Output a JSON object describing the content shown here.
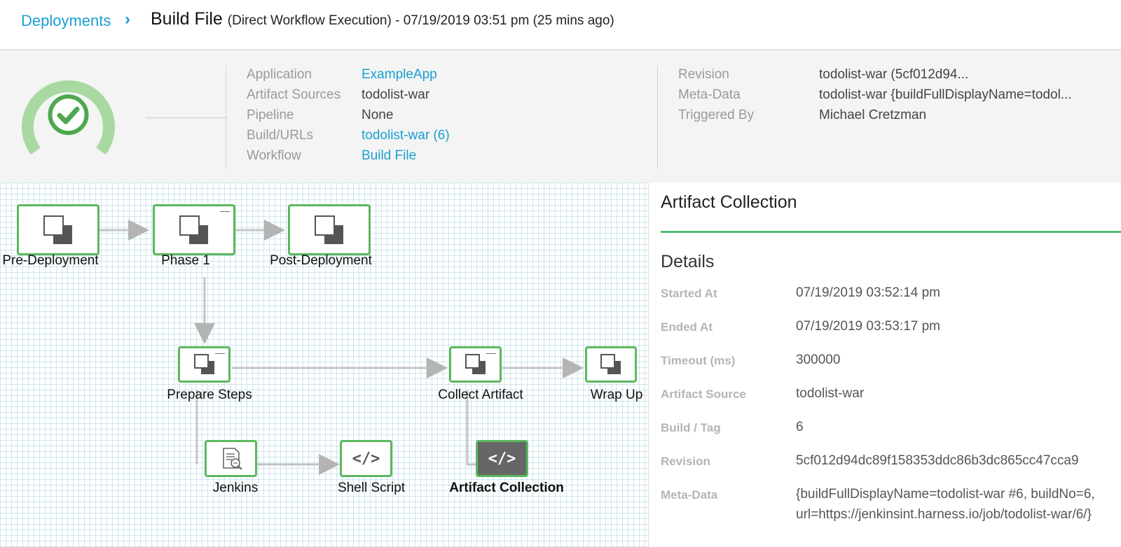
{
  "breadcrumb": {
    "link": "Deployments",
    "separator": "›",
    "title": "Build File",
    "subtitle": "(Direct Workflow Execution) - 07/19/2019 03:51 pm (25 mins ago)"
  },
  "summary": {
    "status": "success",
    "status_icon": "check-circle-icon",
    "left": [
      {
        "label": "Application",
        "value": "ExampleApp",
        "link": true
      },
      {
        "label": "Artifact Sources",
        "value": "todolist-war",
        "link": false
      },
      {
        "label": "Pipeline",
        "value": "None",
        "link": false
      },
      {
        "label": "Build/URLs",
        "value": "todolist-war (6)",
        "link": true
      },
      {
        "label": "Workflow",
        "value": "Build File",
        "link": true
      }
    ],
    "right": [
      {
        "label": "Revision",
        "value": "todolist-war (5cf012d94..."
      },
      {
        "label": "Meta-Data",
        "value": "todolist-war {buildFullDisplayName=todol..."
      },
      {
        "label": "Triggered By",
        "value": "Michael Cretzman"
      }
    ]
  },
  "graph": {
    "nodes": [
      {
        "id": "pre",
        "label": "Pre-Deployment",
        "icon": "phase-icon"
      },
      {
        "id": "phase1",
        "label": "Phase 1",
        "icon": "phase-icon",
        "collapse": "—"
      },
      {
        "id": "post",
        "label": "Post-Deployment",
        "icon": "phase-icon"
      },
      {
        "id": "prepare",
        "label": "Prepare Steps",
        "icon": "phase-icon",
        "collapse": "—"
      },
      {
        "id": "collect",
        "label": "Collect Artifact",
        "icon": "phase-icon",
        "collapse": "—"
      },
      {
        "id": "wrap",
        "label": "Wrap Up",
        "icon": "phase-icon"
      },
      {
        "id": "jenkins",
        "label": "Jenkins",
        "icon": "jenkins-icon"
      },
      {
        "id": "shell",
        "label": "Shell Script",
        "icon": "code-icon",
        "glyph": "</>"
      },
      {
        "id": "artifact",
        "label": "Artifact Collection",
        "icon": "code-icon",
        "glyph": "</>",
        "selected": true
      }
    ]
  },
  "details": {
    "title": "Artifact Collection",
    "heading": "Details",
    "accent": "#4fbf72",
    "rows": [
      {
        "label": "Started At",
        "value": "07/19/2019 03:52:14 pm"
      },
      {
        "label": "Ended At",
        "value": "07/19/2019 03:53:17 pm"
      },
      {
        "label": "Timeout (ms)",
        "value": "300000"
      },
      {
        "label": "Artifact Source",
        "value": "todolist-war"
      },
      {
        "label": "Build / Tag",
        "value": "6"
      },
      {
        "label": "Revision",
        "value": "5cf012d94dc89f158353ddc86b3dc865cc47cca9"
      },
      {
        "label": "Meta-Data",
        "value": "{buildFullDisplayName=todolist-war #6, buildNo=6,",
        "value2": "url=https://jenkinsint.harness.io/job/todolist-war/6/}"
      }
    ]
  },
  "colors": {
    "link": "#1a9fd0",
    "success": "#5cb85c",
    "ring": "#a8d9a0"
  }
}
